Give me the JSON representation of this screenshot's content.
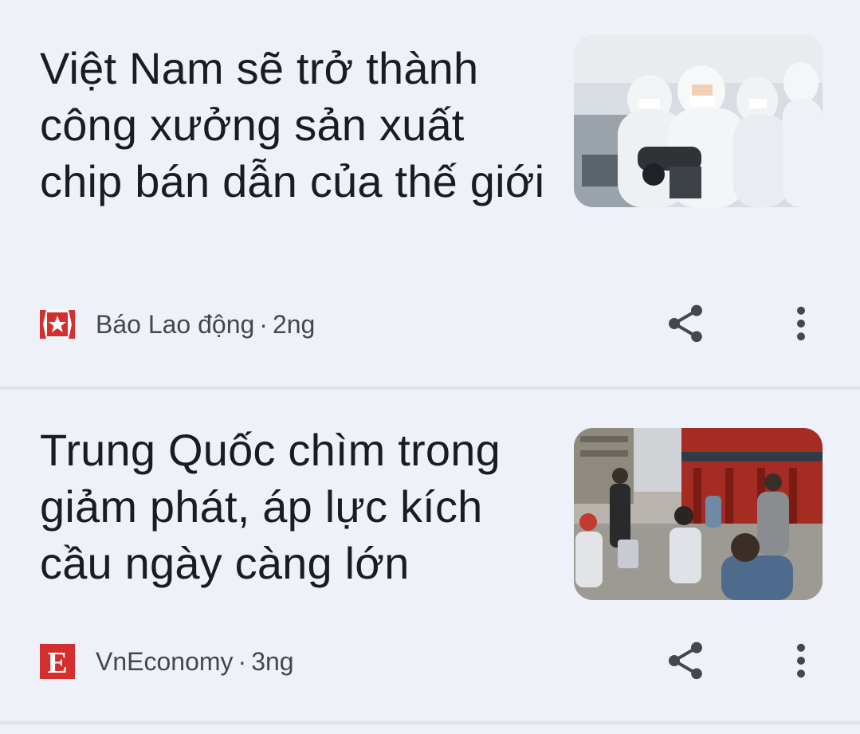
{
  "articles": [
    {
      "headline": "Việt Nam sẽ trở thành công xưởng sản xuất chip bán dẫn của thế giới",
      "publisher": "Báo Lao động",
      "age": "2ng",
      "publisher_icon": "star-badge-icon",
      "thumbnail": "cleanroom-workers-image",
      "accent_color": "#d32f2f"
    },
    {
      "headline": "Trung Quốc chìm trong giảm phát, áp lực kích cầu ngày càng lớn",
      "publisher": "VnEconomy",
      "age": "3ng",
      "publisher_icon": "letter-e-logo-icon",
      "thumbnail": "street-crowd-image",
      "accent_color": "#d32f2f"
    }
  ],
  "actions": {
    "share_icon": "share-icon",
    "more_icon": "more-vert-icon"
  },
  "colors": {
    "background": "#eff1f9",
    "headline": "#1b1c22",
    "meta": "#45464f",
    "icon": "#45464f"
  }
}
